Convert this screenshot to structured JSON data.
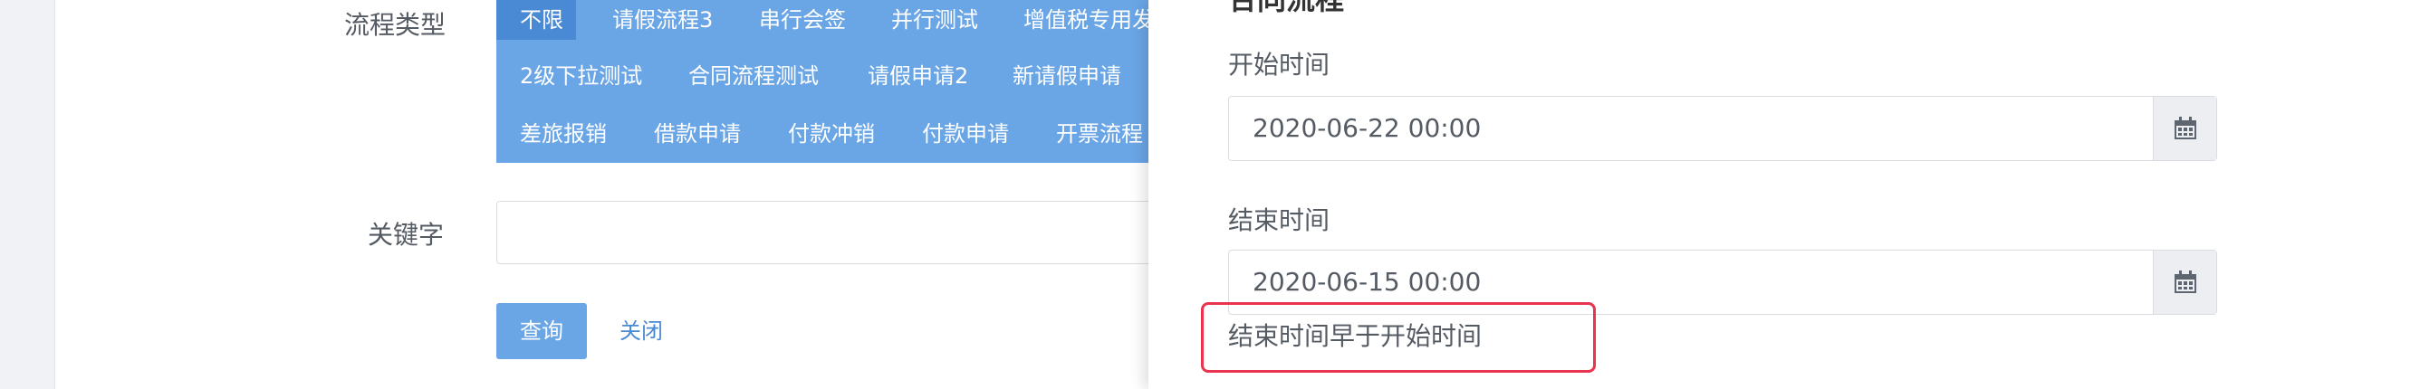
{
  "filter": {
    "flow_type_label": "流程类型",
    "flow_types": [
      "不限",
      "请假流程3",
      "串行会签",
      "并行测试",
      "增值税专用发",
      "2级下拉测试",
      "合同流程测试",
      "请假申请2",
      "新请假申请",
      "差旅报销",
      "借款申请",
      "付款冲销",
      "付款申请",
      "开票流程"
    ],
    "selected_flow_type": "不限",
    "keyword_label": "关键字",
    "keyword_value": "",
    "query_button": "查询",
    "close_link": "关闭"
  },
  "drawer": {
    "heading": "合同流程",
    "start_label": "开始时间",
    "start_value": "2020-06-22 00:00",
    "end_label": "结束时间",
    "end_value": "2020-06-15 00:00",
    "error_message": "结束时间早于开始时间"
  },
  "colors": {
    "primary": "#6aa6e6",
    "primary_active": "#4a8ad4",
    "highlight_border": "#e8344e"
  },
  "icons": {
    "calendar": "calendar-icon"
  }
}
